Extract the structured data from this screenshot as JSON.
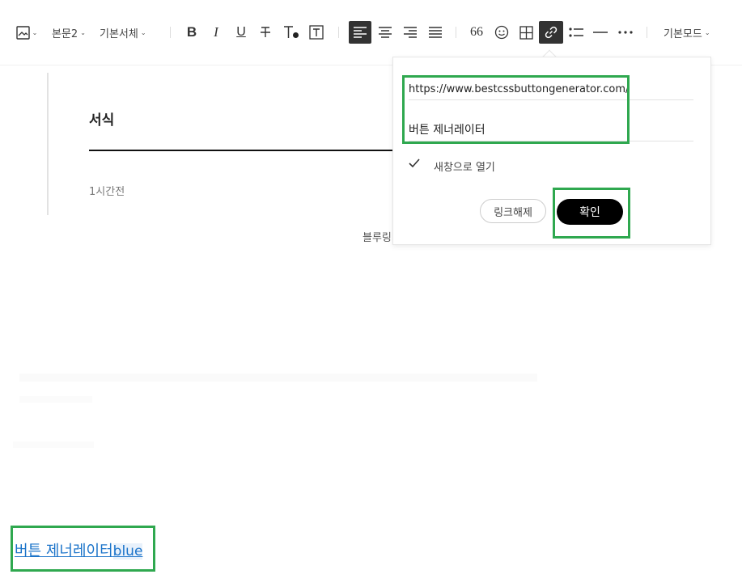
{
  "toolbar": {
    "paragraph_style": "본문2",
    "font": "기본서체",
    "mode": "기본모드",
    "quote_glyph": "66"
  },
  "post": {
    "title": "서식",
    "time": "1시간전",
    "caption": "블루링"
  },
  "link_popup": {
    "url": "https://www.bestcssbuttongenerator.com/",
    "text": "버튼 제너레이터",
    "open_new_window_label": "새창으로 열기",
    "open_new_window_checked": true,
    "unlink_label": "링크해제",
    "confirm_label": "확인"
  },
  "content": {
    "link_text": "버튼 제너레이터",
    "link_suffix": "blue"
  },
  "colors": {
    "highlight": "#2fa84f",
    "link": "#1a73c9",
    "active_button": "#333333"
  },
  "icons": [
    "image-icon",
    "bold-icon",
    "italic-icon",
    "underline-icon",
    "strikethrough-icon",
    "font-color-icon",
    "text-background-icon",
    "align-left-icon",
    "align-center-icon",
    "align-right-icon",
    "align-justify-icon",
    "quote-icon",
    "emoji-icon",
    "table-icon",
    "link-icon",
    "list-icon",
    "horizontal-line-icon",
    "more-icon",
    "check-icon"
  ]
}
